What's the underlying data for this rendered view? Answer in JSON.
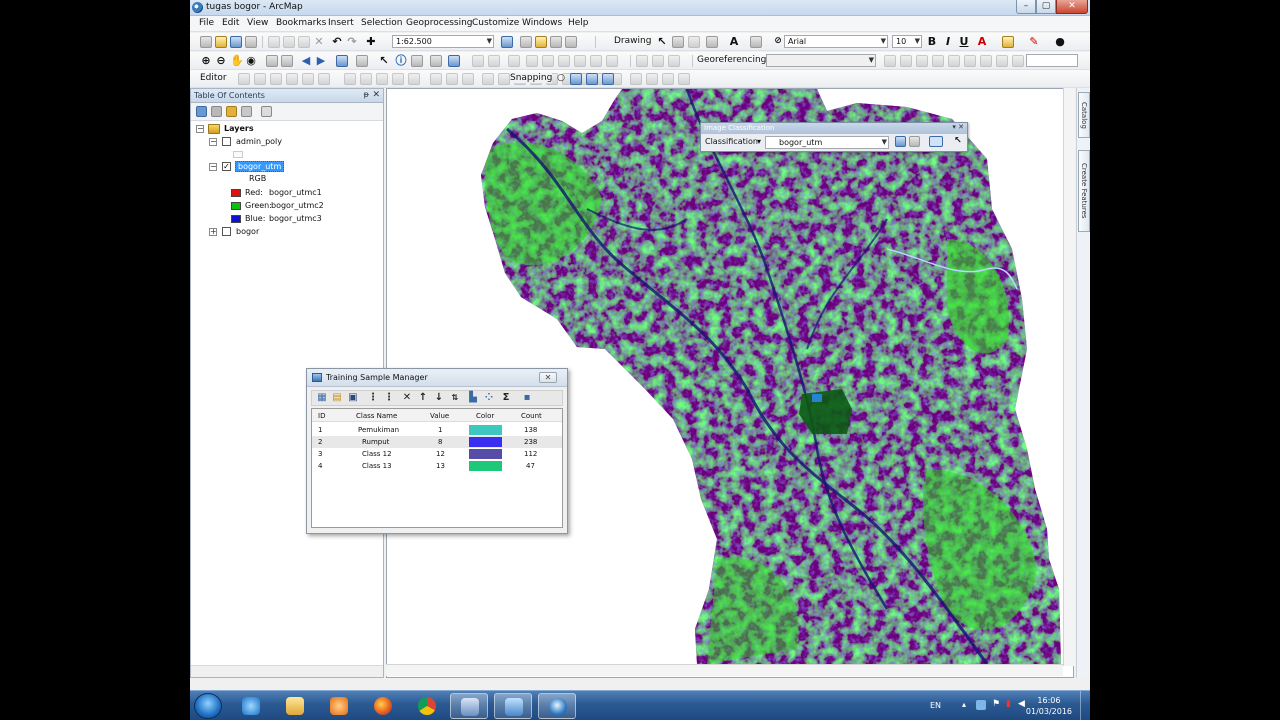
{
  "window": {
    "title": "tugas bogor - ArcMap",
    "min": "–",
    "max": "▢",
    "close": "✕"
  },
  "menu": [
    "File",
    "Edit",
    "View",
    "Bookmarks",
    "Insert",
    "Selection",
    "Geoprocessing",
    "Customize",
    "Windows",
    "Help"
  ],
  "toolbar": {
    "scale": "1:62.500",
    "drawing_label": "Drawing",
    "font_name": "Arial",
    "font_size": "10",
    "bold": "B",
    "italic": "I",
    "underline": "U",
    "text_tool": "A",
    "georeferencing_label": "Georeferencing",
    "editor_label": "Editor",
    "snapping_label": "Snapping"
  },
  "toc": {
    "header": "Table Of Contents",
    "pin": "ᵽ",
    "close": "✕",
    "root": "Layers",
    "layers": [
      {
        "name": "admin_poly",
        "checked": false,
        "expander": "⊟"
      },
      {
        "name": "bogor_utm",
        "checked": true,
        "expander": "⊟",
        "rgb_label": "RGB",
        "bands": [
          {
            "label": "Red:",
            "band": "bogor_utmc1",
            "color": "#e01010"
          },
          {
            "label": "Green:",
            "band": "bogor_utmc2",
            "color": "#10c010"
          },
          {
            "label": "Blue:",
            "band": "bogor_utmc3",
            "color": "#1010d0"
          }
        ]
      },
      {
        "name": "bogor",
        "checked": false,
        "expander": "⊞"
      }
    ]
  },
  "image_classification": {
    "title": "Image Classification",
    "classification_label": "Classification",
    "layer": "bogor_utm"
  },
  "training_sample_manager": {
    "title": "Training Sample Manager",
    "close": "✕",
    "columns": [
      "ID",
      "Class Name",
      "Value",
      "Color",
      "Count"
    ],
    "rows": [
      {
        "id": "1",
        "name": "Pemukiman",
        "value": "1",
        "color": "#3cc8c0",
        "count": "138"
      },
      {
        "id": "2",
        "name": "Rumput",
        "value": "8",
        "color": "#3a2ef0",
        "count": "238"
      },
      {
        "id": "3",
        "name": "Class 12",
        "value": "12",
        "color": "#574ca8",
        "count": "112"
      },
      {
        "id": "4",
        "name": "Class 13",
        "value": "13",
        "color": "#1ec87a",
        "count": "47"
      }
    ]
  },
  "side_tabs": [
    "Catalog",
    "Create Features"
  ],
  "taskbar": {
    "language": "EN",
    "time": "16:06",
    "date": "01/03/2016"
  },
  "colors": {
    "magenta": "#e020d0",
    "green": "#30e020",
    "navy": "#1a1a70"
  }
}
